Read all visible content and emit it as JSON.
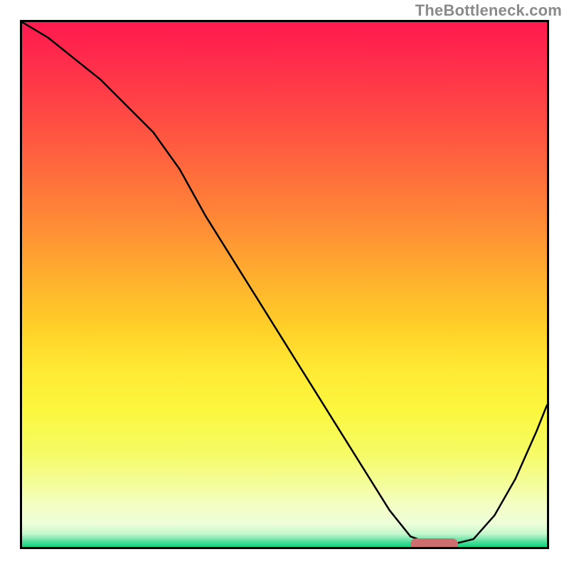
{
  "watermark": "TheBottleneck.com",
  "chart_data": {
    "type": "line",
    "title": "",
    "xlabel": "",
    "ylabel": "",
    "xlim": [
      0,
      100
    ],
    "ylim": [
      0,
      100
    ],
    "x": [
      0,
      5,
      10,
      15,
      20,
      25,
      30,
      35,
      40,
      45,
      50,
      55,
      60,
      65,
      70,
      74,
      78,
      82,
      86,
      90,
      94,
      98,
      100
    ],
    "y": [
      100,
      97,
      93,
      89,
      84,
      79,
      72,
      63,
      55,
      47,
      39,
      31,
      23,
      15,
      7,
      2,
      0.5,
      0.5,
      1.5,
      6,
      13,
      22,
      27
    ],
    "marker": {
      "x_start": 74,
      "x_end": 83,
      "y": 0.5
    },
    "gradient_stops": [
      {
        "pos": 0.0,
        "color": "#ff1a4e"
      },
      {
        "pos": 0.08,
        "color": "#ff2e4b"
      },
      {
        "pos": 0.18,
        "color": "#ff4a44"
      },
      {
        "pos": 0.28,
        "color": "#ff6a3d"
      },
      {
        "pos": 0.38,
        "color": "#ff8a36"
      },
      {
        "pos": 0.48,
        "color": "#ffad2f"
      },
      {
        "pos": 0.58,
        "color": "#ffcf28"
      },
      {
        "pos": 0.66,
        "color": "#ffe933"
      },
      {
        "pos": 0.74,
        "color": "#fbf73e"
      },
      {
        "pos": 0.82,
        "color": "#f6fb64"
      },
      {
        "pos": 0.88,
        "color": "#f4fd9a"
      },
      {
        "pos": 0.92,
        "color": "#f3fec4"
      },
      {
        "pos": 0.955,
        "color": "#eefed8"
      },
      {
        "pos": 0.975,
        "color": "#c6f7cf"
      },
      {
        "pos": 0.99,
        "color": "#4fe09a"
      },
      {
        "pos": 1.0,
        "color": "#0fd27f"
      }
    ]
  }
}
